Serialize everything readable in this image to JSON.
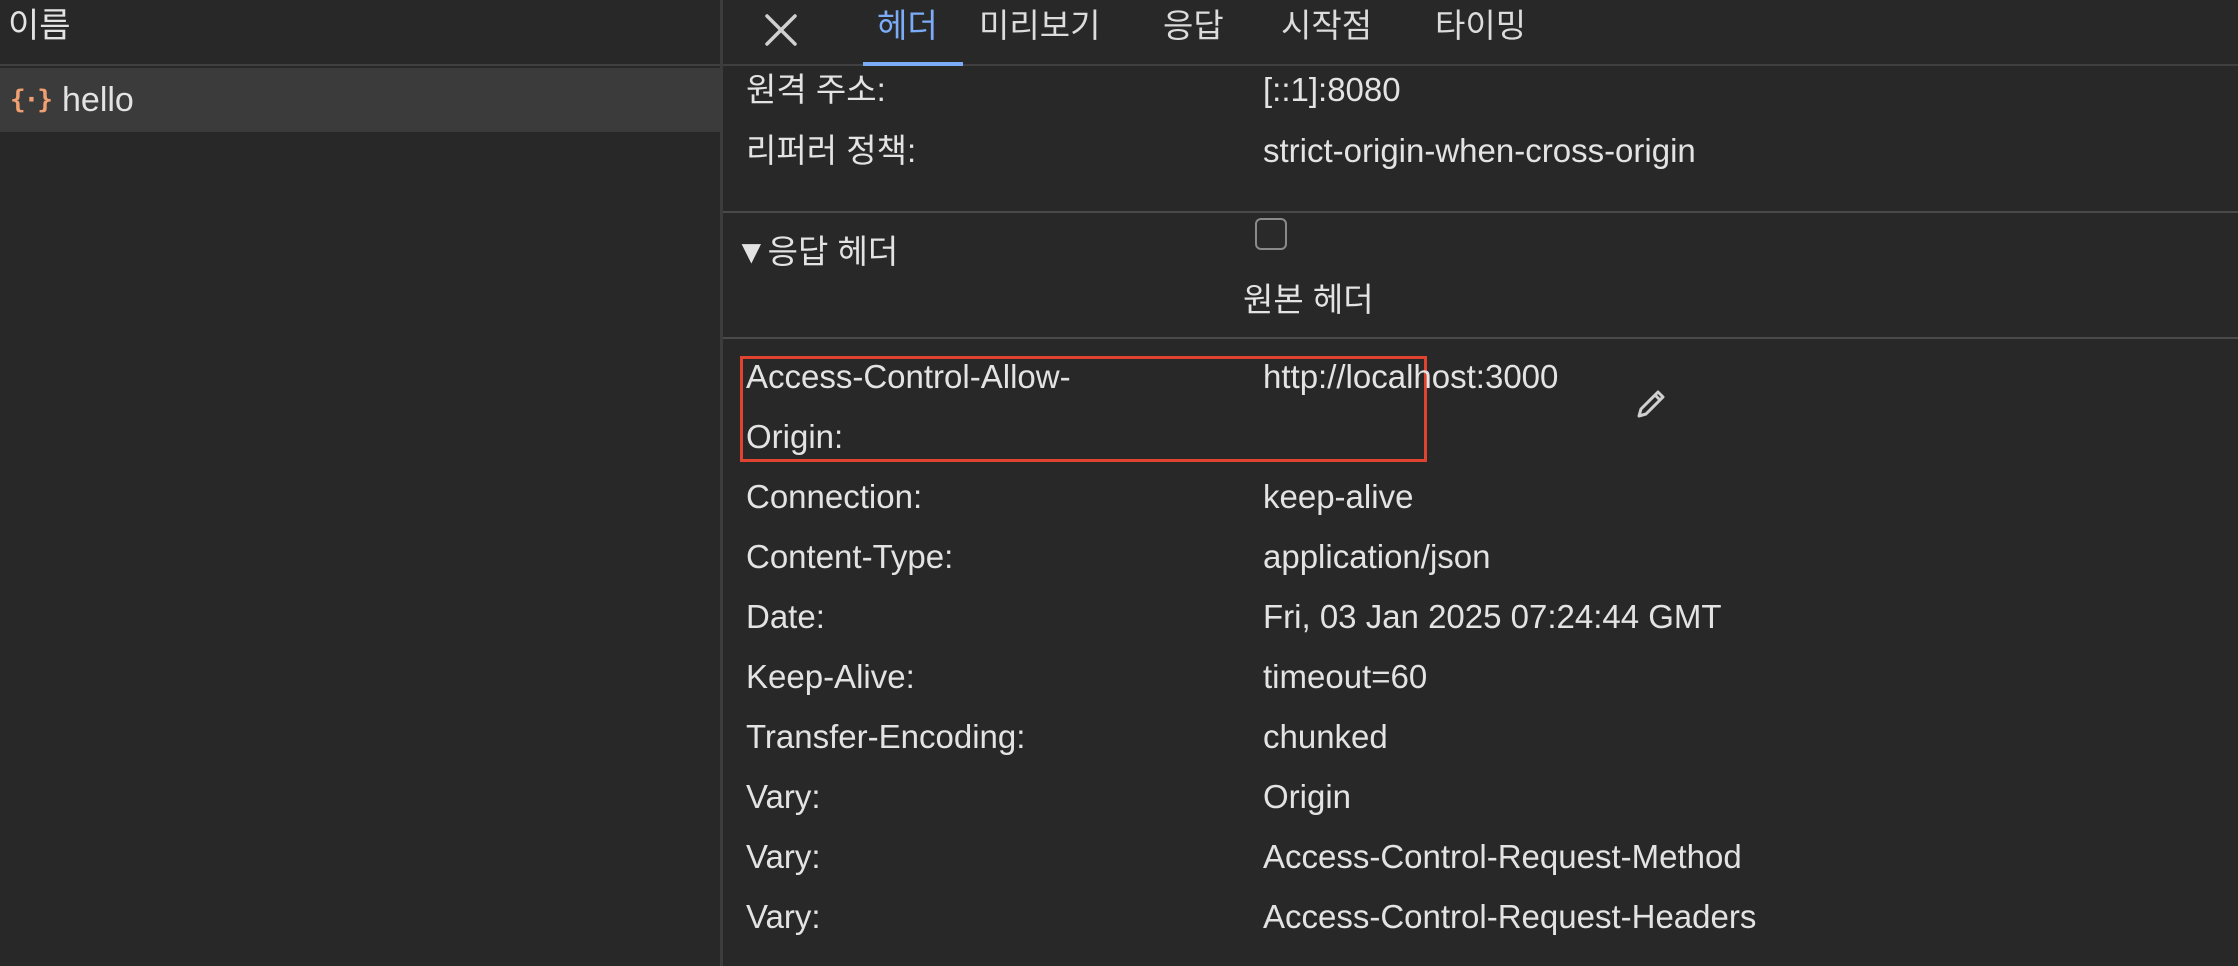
{
  "left_panel": {
    "column_header": "이름",
    "requests": [
      {
        "name": "hello",
        "icon": "json-braces-icon"
      }
    ]
  },
  "tabs": [
    {
      "label": "헤더",
      "active": true
    },
    {
      "label": "미리보기",
      "active": false
    },
    {
      "label": "응답",
      "active": false
    },
    {
      "label": "시작점",
      "active": false
    },
    {
      "label": "타이밍",
      "active": false
    }
  ],
  "general": [
    {
      "key": "원격 주소:",
      "value": "[::1]:8080"
    },
    {
      "key": "리퍼러 정책:",
      "value": "strict-origin-when-cross-origin"
    }
  ],
  "response_section": {
    "title": "▼응답 헤더",
    "raw_label": "원본 헤더",
    "raw_checked": false
  },
  "response_headers": [
    {
      "key_line1": "Access-Control-Allow-",
      "key_line2": "Origin:",
      "value": "http://localhost:3000"
    },
    {
      "key": "Connection:",
      "value": "keep-alive"
    },
    {
      "key": "Content-Type:",
      "value": "application/json"
    },
    {
      "key": "Date:",
      "value": "Fri, 03 Jan 2025 07:24:44 GMT"
    },
    {
      "key": "Keep-Alive:",
      "value": "timeout=60"
    },
    {
      "key": "Transfer-Encoding:",
      "value": "chunked"
    },
    {
      "key": "Vary:",
      "value": "Origin"
    },
    {
      "key": "Vary:",
      "value": "Access-Control-Request-Method"
    },
    {
      "key": "Vary:",
      "value": "Access-Control-Request-Headers"
    }
  ],
  "colors": {
    "accent": "#7cacf8",
    "highlight": "#e0432f",
    "json_icon": "#f0a070"
  }
}
